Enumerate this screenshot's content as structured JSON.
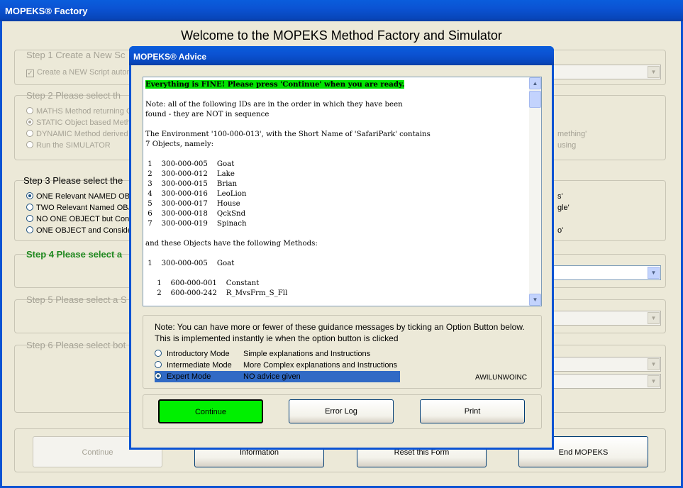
{
  "window": {
    "title": "MOPEKS® Factory"
  },
  "heading": "Welcome to the MOPEKS Method Factory and Simulator",
  "step1": {
    "title": "Step 1    Create a New Sc",
    "option": "Create a NEW Script autom"
  },
  "step2": {
    "title": "Step 2    Please select th",
    "options": [
      "MATHS Method returning C",
      "STATIC Object based Meth",
      "DYNAMIC Method derived",
      "Run the SIMULATOR"
    ],
    "right_fragments": [
      "mething'",
      "using"
    ]
  },
  "step3": {
    "title": "Step 3    Please select the",
    "options": [
      "ONE Relevant NAMED OBJ",
      "TWO Relevant Named OBJ",
      "NO ONE OBJECT but Consi",
      "ONE OBJECT and Consider"
    ],
    "right_fragments": [
      "s'",
      "gle'",
      "o'"
    ]
  },
  "step4": {
    "title": "Step 4    Please select a"
  },
  "step5": {
    "title": "Step 5    Please select a S"
  },
  "step6": {
    "title": "Step 6    Please select bot"
  },
  "bottom_buttons": [
    "Continue",
    "Information",
    "Reset this Form",
    "End MOPEKS"
  ],
  "dialog": {
    "title": "MOPEKS® Advice",
    "advice_lines": [
      "Everything is FINE! Please press 'Continue' when you are ready.",
      "",
      "Note: all of the following IDs are in the order in which they have been",
      "found - they are NOT in sequence",
      "",
      "The Environment '100-000-013', with the Short Name of 'SafariPark' contains",
      "7 Objects, namely:",
      "",
      " 1    300-000-005    Goat",
      " 2    300-000-012    Lake",
      " 3    300-000-015    Brian",
      " 4    300-000-016    LeoLion",
      " 5    300-000-017    House",
      " 6    300-000-018    QckSnd",
      " 7    300-000-019    Spinach",
      "",
      "and these Objects have the following Methods:",
      "",
      " 1    300-000-005    Goat",
      "",
      "     1    600-000-001    Constant",
      "     2    600-000-242    R_MvsFrm_S_Fll"
    ],
    "note": "Note: You can have more or fewer of these guidance messages by ticking an Option Button below. This is implemented instantly ie when the option button is clicked",
    "modes": [
      {
        "name": "Introductory Mode",
        "desc": "Simple explanations and Instructions"
      },
      {
        "name": "Intermediate Mode",
        "desc": "More Complex explanations and Instructions"
      },
      {
        "name": "Expert Mode",
        "desc": "NO advice given"
      }
    ],
    "selected_mode": "Expert Mode",
    "code": "AWILUNWOINC",
    "buttons": {
      "continue": "Continue",
      "error_log": "Error Log",
      "print": "Print"
    },
    "colors": {
      "highlight": "#00e400",
      "continue_button": "#00f000",
      "selection": "#316ac5"
    }
  }
}
